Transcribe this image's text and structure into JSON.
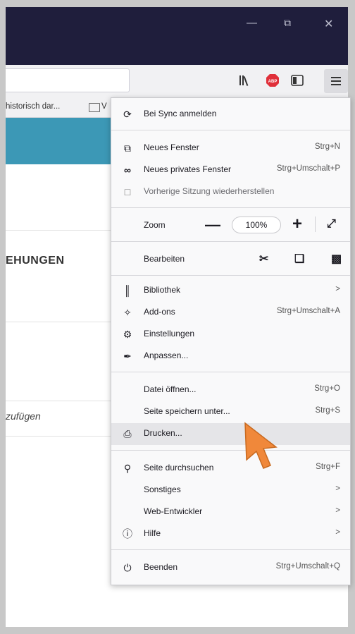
{
  "window": {
    "minimize_icon": "minimize-icon",
    "restore_icon": "restore-icon",
    "close_icon": "close-icon"
  },
  "bookmarks_bar": {
    "item1": "historisch dar...",
    "item2": "V"
  },
  "page": {
    "heading": "EHUNGEN",
    "italic_text": "zufügen"
  },
  "menu": {
    "sync": "Bei Sync anmelden",
    "new_window": "Neues Fenster",
    "new_window_sc": "Strg+N",
    "private_window": "Neues privates Fenster",
    "private_window_sc": "Strg+Umschalt+P",
    "restore_session": "Vorherige Sitzung wiederherstellen",
    "zoom": "Zoom",
    "zoom_minus": "—",
    "zoom_value": "100%",
    "zoom_plus": "+",
    "edit": "Bearbeiten",
    "library": "Bibliothek",
    "library_arrow": ">",
    "addons": "Add-ons",
    "addons_sc": "Strg+Umschalt+A",
    "settings": "Einstellungen",
    "customize": "Anpassen...",
    "open_file": "Datei öffnen...",
    "open_file_sc": "Strg+O",
    "save_page": "Seite speichern unter...",
    "save_page_sc": "Strg+S",
    "print": "Drucken...",
    "find": "Seite durchsuchen",
    "find_sc": "Strg+F",
    "more": "Sonstiges",
    "more_arrow": ">",
    "webdev": "Web-Entwickler",
    "webdev_arrow": ">",
    "help": "Hilfe",
    "help_arrow": ">",
    "quit": "Beenden",
    "quit_sc": "Strg+Umschalt+Q"
  },
  "colors": {
    "titlebar": "#1f1e3c",
    "accent_band": "#3c98b6",
    "adblock_badge": "#e0303a",
    "cursor": "#f0883a"
  }
}
